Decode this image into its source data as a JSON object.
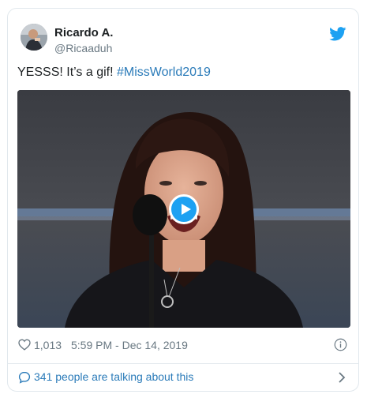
{
  "tweet": {
    "author_name": "Ricardo A.",
    "author_handle": "@Ricaaduh",
    "text": "YESSS! It’s a gif! ",
    "hashtag": "#MissWorld2019",
    "likes": "1,013",
    "timestamp": "5:59 PM - Dec 14, 2019",
    "talking": "341 people are talking about this"
  },
  "icons": {
    "brand": "twitter-bird-icon",
    "like": "heart-icon",
    "info": "info-icon",
    "play": "play-icon",
    "conversation": "speech-bubble-icon",
    "more": "chevron-right-icon"
  },
  "colors": {
    "link": "#2b7bb9",
    "twitter_blue": "#1da1f2",
    "secondary_text": "#697882",
    "border": "#e1e8ed"
  }
}
